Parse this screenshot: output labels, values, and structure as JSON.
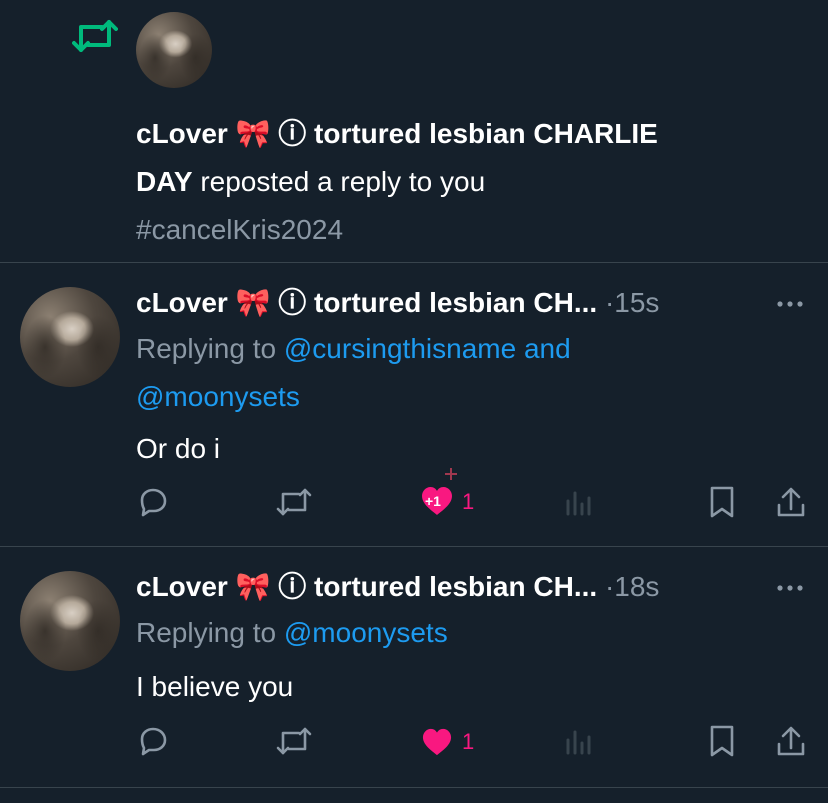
{
  "repost_header": {
    "display_name": "cLover 🎀 ⓘ tortured lesbian CHARLIE DAY",
    "name_line1": "cLover 🎀 ⓘ tortured lesbian CHARLIE",
    "name_line2": "DAY",
    "action_text": " reposted a reply to you",
    "hashtag": "#cancelKris2024",
    "icon": "repost-icon",
    "accent_color": "#00ba7c"
  },
  "tweets": [
    {
      "display_name": "cLover 🎀 ⓘ tortured lesbian CH...",
      "dot": "·",
      "time": "15s",
      "replying_prefix": "Replying to ",
      "replying_users_line1": "@cursingthisname and",
      "replying_users_line2": "@moonysets",
      "text": "Or do i",
      "like_count": "1",
      "like_badge": "+1"
    },
    {
      "display_name": "cLover 🎀 ⓘ tortured lesbian CH...",
      "dot": "·",
      "time": "18s",
      "replying_prefix": "Replying to ",
      "replying_users_line1": "@moonysets",
      "text": "I believe you",
      "like_count": "1"
    }
  ],
  "colors": {
    "background": "#15202b",
    "secondary_text": "#8b98a5",
    "link": "#1d9bf0",
    "like": "#f91880",
    "repost": "#00ba7c"
  }
}
